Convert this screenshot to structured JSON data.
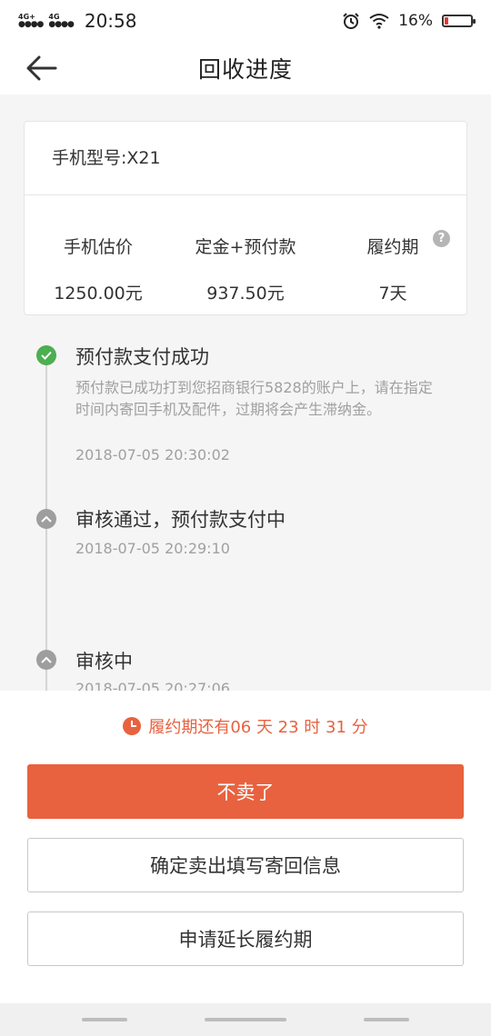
{
  "status_bar": {
    "signal_1": "4G+",
    "signal_2": "4G",
    "time": "20:58",
    "battery_text": "16%",
    "battery_level": 0.16
  },
  "nav": {
    "title": "回收进度"
  },
  "phone_card": {
    "model": "手机型号:X21",
    "columns": [
      {
        "label": "手机估价",
        "value": "1250.00元"
      },
      {
        "label": "定金+预付款",
        "value": "937.50元"
      },
      {
        "label": "履约期",
        "value": "7天"
      }
    ],
    "help_icon": "?"
  },
  "timeline": [
    {
      "status": "done",
      "title": "预付款支付成功",
      "desc": "预付款已成功打到您招商银行5828的账户上，请在指定时间内寄回手机及配件，过期将会产生滞纳金。",
      "time": "2018-07-05 20:30:02"
    },
    {
      "status": "pending",
      "title": "审核通过，预付款支付中",
      "desc": "",
      "time": "2018-07-05 20:29:10"
    },
    {
      "status": "pending",
      "title": "审核中",
      "desc": "",
      "time": "2018-07-05 20:27:06"
    }
  ],
  "countdown": "履约期还有06 天 23 时 31 分",
  "buttons": {
    "cancel": "不卖了",
    "confirm_sell": "确定卖出填写寄回信息",
    "extend": "申请延长履约期"
  },
  "colors": {
    "accent": "#e8623f",
    "success": "#4caf50",
    "pending": "#9e9e9e"
  }
}
